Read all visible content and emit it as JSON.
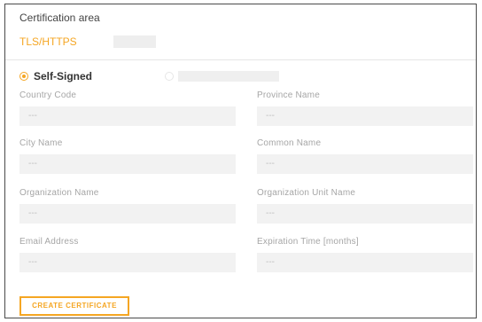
{
  "header": {
    "title": "Certification area",
    "tab_label": "TLS/HTTPS"
  },
  "options": {
    "selected_label": "Self-Signed"
  },
  "fields": [
    {
      "label": "Country Code",
      "value": "---"
    },
    {
      "label": "Province Name",
      "value": "---"
    },
    {
      "label": "City Name",
      "value": "---"
    },
    {
      "label": "Common Name",
      "value": "---"
    },
    {
      "label": "Organization Name",
      "value": "---"
    },
    {
      "label": "Organization Unit Name",
      "value": "---"
    },
    {
      "label": "Email Address",
      "value": "---"
    },
    {
      "label": "Expiration Time [months]",
      "value": "---"
    }
  ],
  "actions": {
    "create_label": "CREATE CERTIFICATE"
  },
  "colors": {
    "accent": "#f5a623",
    "input_bg": "#f2f2f2",
    "label_text": "#a6a6a6"
  }
}
